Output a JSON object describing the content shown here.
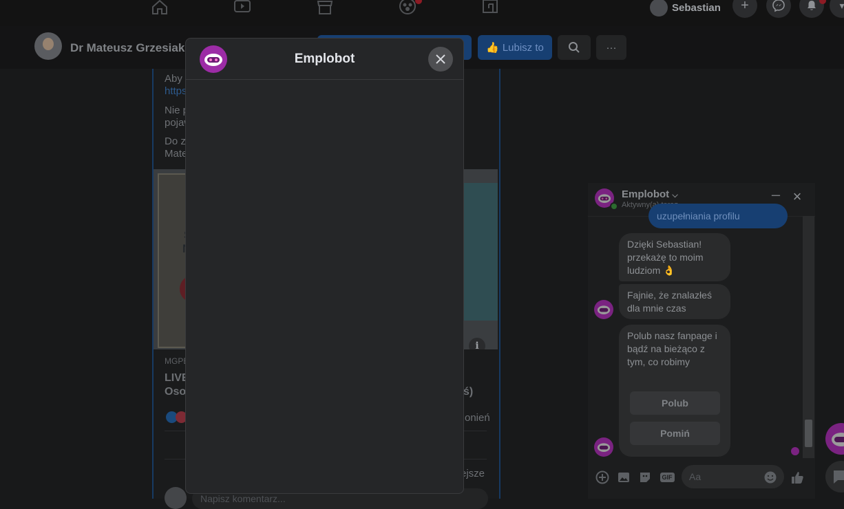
{
  "topbar": {
    "user_name": "Sebastian",
    "icons": [
      "home-icon",
      "watch-icon",
      "marketplace-icon",
      "groups-icon",
      "gaming-icon",
      "plus-icon",
      "messenger-icon",
      "bell-icon",
      "menu-icon"
    ]
  },
  "page_header": {
    "page_name": "Dr Mateusz Grzesiak",
    "like_button_label": "Lubisz to"
  },
  "post": {
    "text_line_1": "Aby",
    "link_text": "https",
    "text_line_2": "Nie p",
    "text_line_3": "pojaw",
    "text_line_4": "Do z",
    "text_line_5": "Mate",
    "image_text_1": "S",
    "image_text_2": "N",
    "link_source": "MGPE",
    "link_title_1": "LIVE",
    "link_title_2": "Oso",
    "link_title_tail": "ś)",
    "stats_tail": "onień",
    "sort_tail": "ejsze",
    "comment_placeholder": "Napisz komentarz..."
  },
  "modal": {
    "title": "Emplobot"
  },
  "chat": {
    "name": "Emplobot",
    "status": "Aktywny(a) teraz",
    "my_message_partial": "uzupełniania profilu",
    "bot_messages": [
      "Dzięki Sebastian! przekażę to moim ludziom 👌",
      "Fajnie, że znalazłeś dla mnie czas",
      "Polub nasz fanpage i bądź na bieżąco z tym, co robimy"
    ],
    "quick_replies": [
      "Polub",
      "Pomiń"
    ],
    "input_placeholder": "Aa",
    "gif_label": "GIF"
  },
  "colors": {
    "bot_purple": "#9c2ca6",
    "fb_blue": "#1877f2",
    "modal_bg": "#252628"
  }
}
